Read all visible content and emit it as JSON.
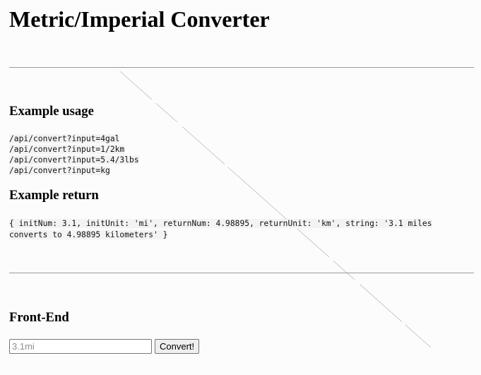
{
  "header": {
    "title": "Metric/Imperial Converter"
  },
  "usage": {
    "heading": "Example usage",
    "examples": [
      "/api/convert?input=4gal",
      "/api/convert?input=1/2km",
      "/api/convert?input=5.4/3lbs",
      "/api/convert?input=kg"
    ]
  },
  "return_section": {
    "heading": "Example return",
    "code": "{ initNum: 3.1, initUnit: 'mi', returnNum: 4.98895, returnUnit: 'km', string: '3.1 miles converts to 4.98895 kilometers' }"
  },
  "frontend": {
    "heading": "Front-End",
    "input_placeholder": "3.1mi",
    "input_value": "",
    "button_label": "Convert!"
  }
}
